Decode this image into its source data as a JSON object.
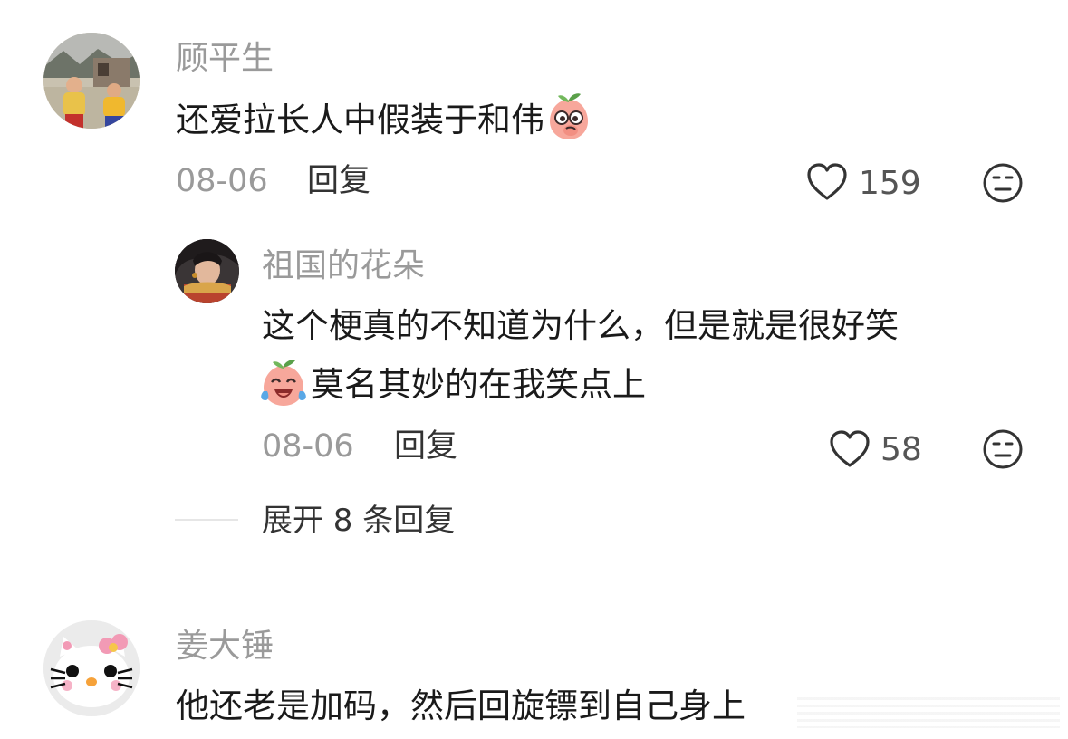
{
  "comments": [
    {
      "username": "顾平生",
      "text": "还爱拉长人中假装于和伟",
      "date": "08-06",
      "reply_label": "回复",
      "likes": "159",
      "replies": [
        {
          "username": "祖国的花朵",
          "text_line1": "这个梗真的不知道为什么，但是就是很好笑",
          "text_line2": "莫名其妙的在我笑点上",
          "date": "08-06",
          "reply_label": "回复",
          "likes": "58"
        }
      ],
      "expand_label": "展开 8 条回复"
    },
    {
      "username": "姜大锤",
      "text": "他还老是加码，然后回旋镖到自己身上"
    }
  ],
  "colors": {
    "username": "#9a9a9a",
    "text": "#1a1a1a",
    "meta": "#9a9a9a",
    "emoji_peach": "#f7a79b"
  },
  "icons": {
    "like": "heart-outline-icon",
    "dislike": "neutral-face-icon",
    "emoji1": "peach-thinking-emoji-icon",
    "emoji2": "peach-crying-laughing-emoji-icon"
  }
}
